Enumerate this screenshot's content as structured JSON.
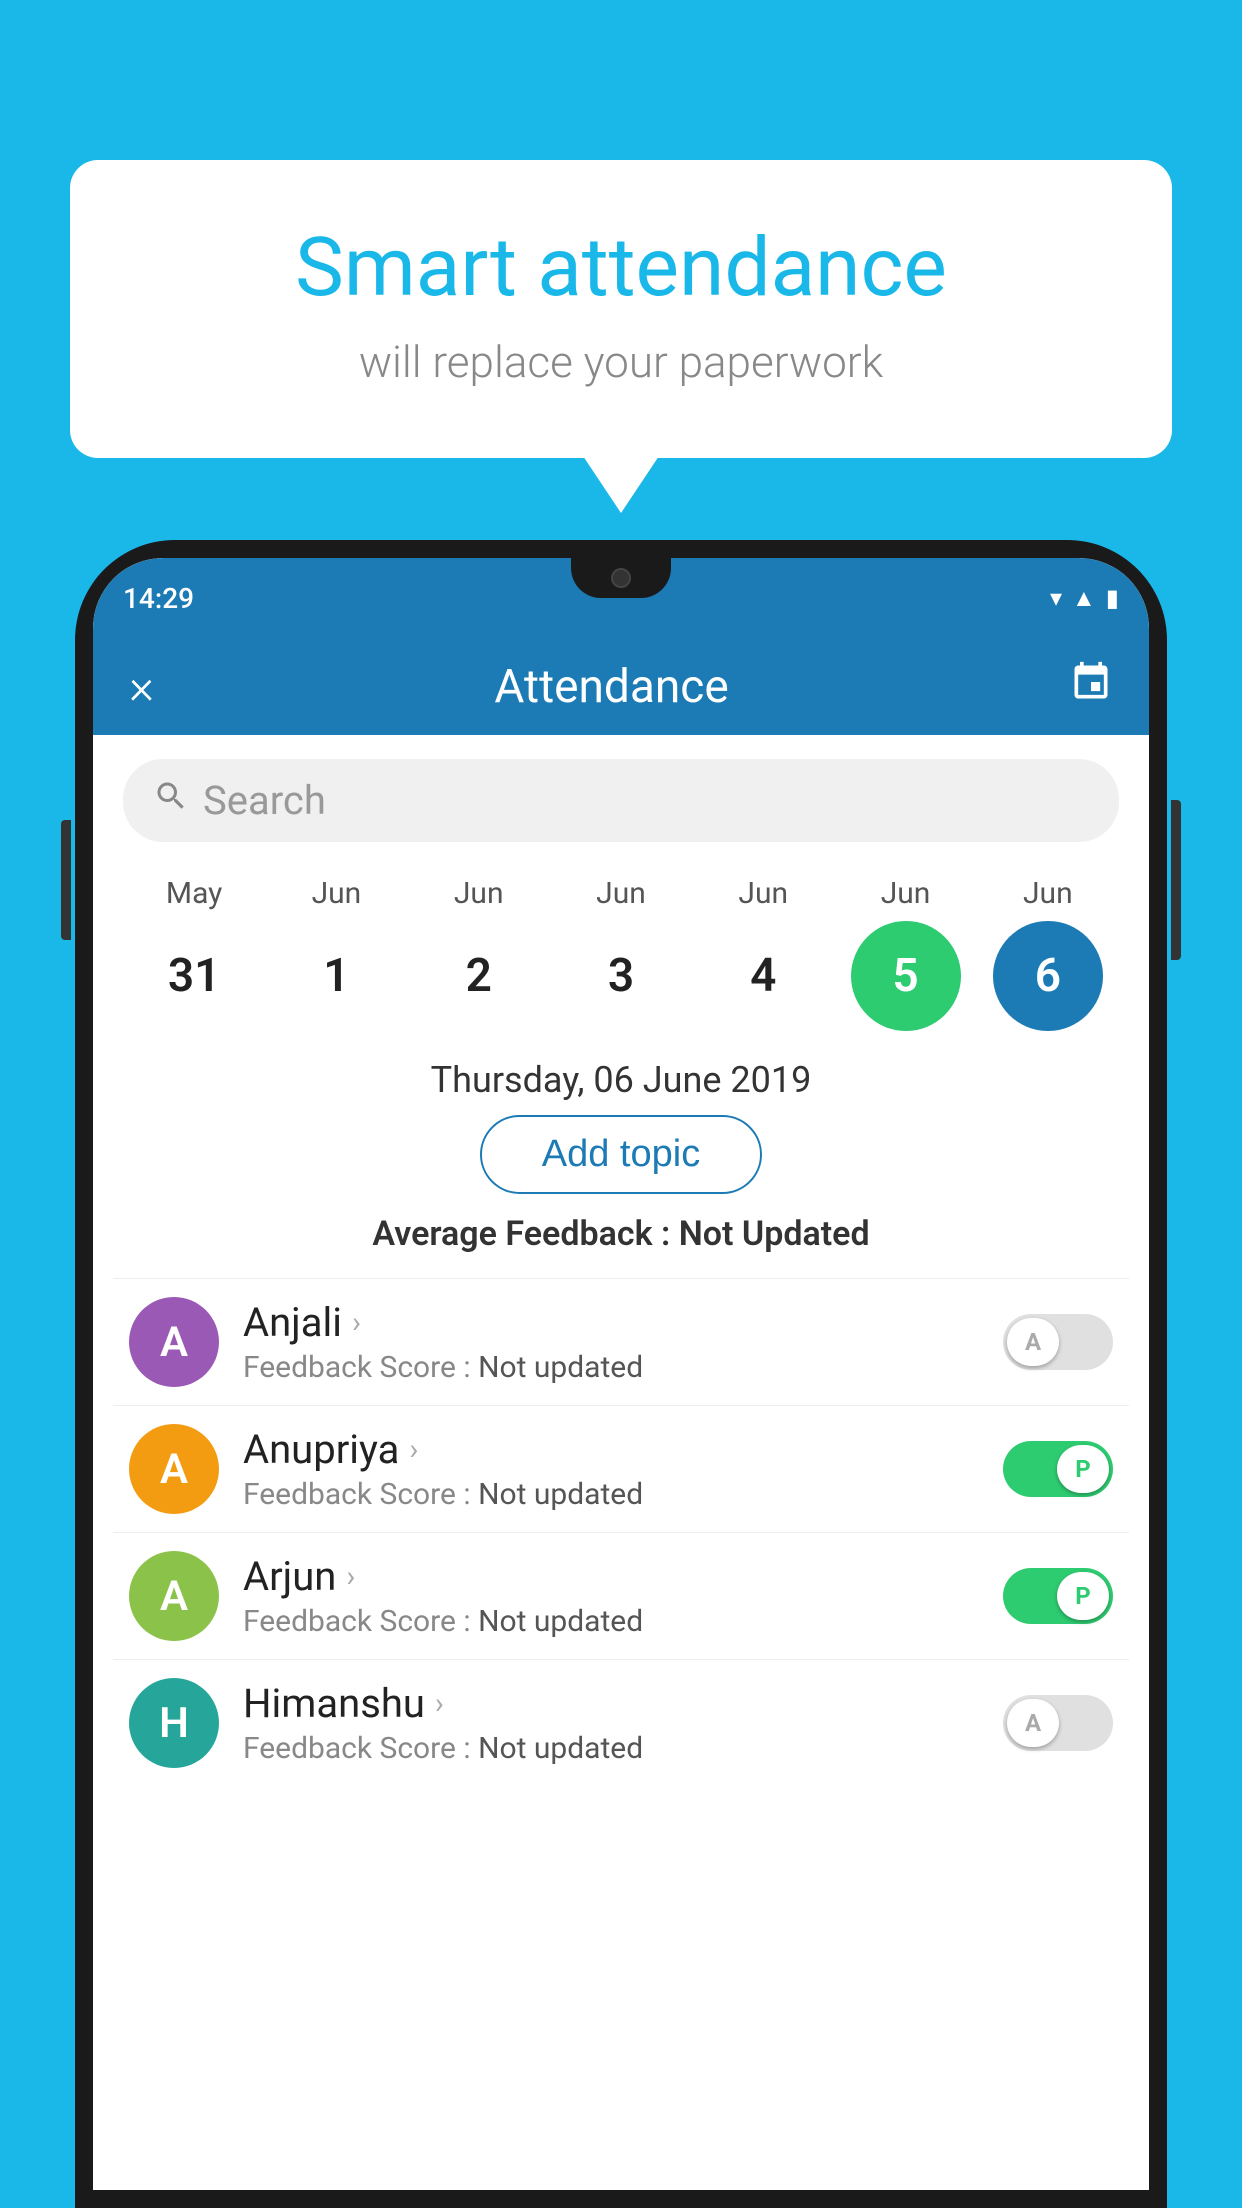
{
  "background_color": "#1ab8e8",
  "speech_bubble": {
    "title": "Smart attendance",
    "subtitle": "will replace your paperwork"
  },
  "status_bar": {
    "time": "14:29",
    "icons": [
      "wifi",
      "signal",
      "battery"
    ]
  },
  "app_header": {
    "close_label": "×",
    "title": "Attendance",
    "calendar_icon": "📅"
  },
  "search": {
    "placeholder": "Search"
  },
  "calendar": {
    "months": [
      "May",
      "Jun",
      "Jun",
      "Jun",
      "Jun",
      "Jun",
      "Jun"
    ],
    "dates": [
      "31",
      "1",
      "2",
      "3",
      "4",
      "5",
      "6"
    ],
    "today_index": 5,
    "selected_index": 6,
    "selected_date_label": "Thursday, 06 June 2019"
  },
  "add_topic_button": "Add topic",
  "avg_feedback": {
    "label": "Average Feedback : ",
    "value": "Not Updated"
  },
  "students": [
    {
      "name": "Anjali",
      "avatar_letter": "A",
      "avatar_color": "avatar-purple",
      "score_label": "Feedback Score : ",
      "score_value": "Not updated",
      "toggle_state": "off",
      "toggle_letter": "A"
    },
    {
      "name": "Anupriya",
      "avatar_letter": "A",
      "avatar_color": "avatar-orange",
      "score_label": "Feedback Score : ",
      "score_value": "Not updated",
      "toggle_state": "on",
      "toggle_letter": "P"
    },
    {
      "name": "Arjun",
      "avatar_letter": "A",
      "avatar_color": "avatar-green",
      "score_label": "Feedback Score : ",
      "score_value": "Not updated",
      "toggle_state": "on",
      "toggle_letter": "P"
    },
    {
      "name": "Himanshu",
      "avatar_letter": "H",
      "avatar_color": "avatar-teal",
      "score_label": "Feedback Score : ",
      "score_value": "Not updated",
      "toggle_state": "off",
      "toggle_letter": "A"
    }
  ]
}
